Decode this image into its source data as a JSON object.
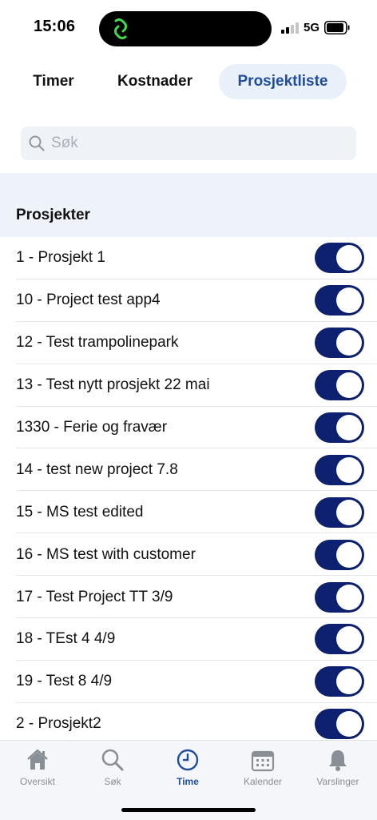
{
  "status": {
    "time": "15:06",
    "network": "5G"
  },
  "tabs": [
    {
      "label": "Timer"
    },
    {
      "label": "Kostnader"
    },
    {
      "label": "Prosjektliste"
    }
  ],
  "search": {
    "placeholder": "Søk",
    "value": ""
  },
  "section": {
    "title": "Prosjekter"
  },
  "projects": [
    {
      "label": "1 - Prosjekt 1",
      "enabled": true
    },
    {
      "label": "10 - Project test app4",
      "enabled": true
    },
    {
      "label": "12 - Test trampolinepark",
      "enabled": true
    },
    {
      "label": "13 - Test nytt prosjekt 22 mai",
      "enabled": true
    },
    {
      "label": "1330 - Ferie og fravær",
      "enabled": true
    },
    {
      "label": "14 - test new project 7.8",
      "enabled": true
    },
    {
      "label": "15 - MS test edited",
      "enabled": true
    },
    {
      "label": "16 - MS test with customer",
      "enabled": true
    },
    {
      "label": "17 - Test Project TT 3/9",
      "enabled": true
    },
    {
      "label": "18 - TEst 4 4/9",
      "enabled": true
    },
    {
      "label": "19 - Test 8 4/9",
      "enabled": true
    },
    {
      "label": "2 - Prosjekt2",
      "enabled": true
    }
  ],
  "nav": [
    {
      "label": "Oversikt",
      "icon": "home-icon"
    },
    {
      "label": "Søk",
      "icon": "search-icon"
    },
    {
      "label": "Time",
      "icon": "clock-icon",
      "active": true
    },
    {
      "label": "Kalender",
      "icon": "calendar-icon"
    },
    {
      "label": "Varslinger",
      "icon": "bell-icon"
    }
  ],
  "colors": {
    "accent": "#1f4e9c",
    "toggle_on": "#0d2170",
    "tab_active_bg": "#eaf0fa",
    "section_bg": "#eef3fa"
  }
}
